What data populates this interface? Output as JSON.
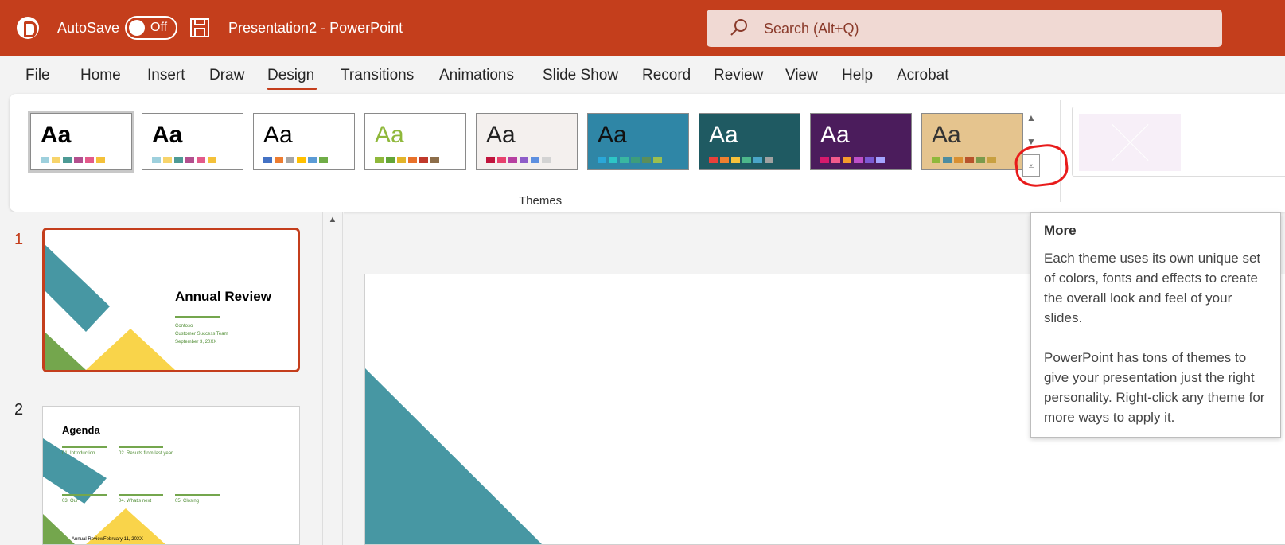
{
  "app": {
    "autosave_label": "AutoSave",
    "autosave_state": "Off",
    "document_title": "Presentation2  -  PowerPoint",
    "search_placeholder": "Search (Alt+Q)"
  },
  "tabs": [
    "File",
    "Home",
    "Insert",
    "Draw",
    "Design",
    "Transitions",
    "Animations",
    "Slide Show",
    "Record",
    "Review",
    "View",
    "Help",
    "Acrobat"
  ],
  "active_tab": "Design",
  "ribbon": {
    "group_label": "Themes",
    "themes": [
      {
        "label": "Aa",
        "bg": "#ffffff",
        "text": "#000000",
        "swatches": [
          "#9ed0dd",
          "#f7d46b",
          "#4d9a95",
          "#b34f8e",
          "#e35a8a",
          "#f4c13a"
        ]
      },
      {
        "label": "Aa",
        "bg": "#ffffff",
        "text": "#000000",
        "swatches": [
          "#9ed0dd",
          "#f7d46b",
          "#4d9a95",
          "#b34f8e",
          "#e35a8a",
          "#f4c13a"
        ]
      },
      {
        "label": "Aa",
        "bg": "#ffffff",
        "text": "#000000",
        "swatches": [
          "#4472c4",
          "#ed7d31",
          "#a5a5a5",
          "#ffc000",
          "#5b9bd5",
          "#70ad47"
        ]
      },
      {
        "label": "Aa",
        "bg": "#ffffff",
        "text": "#8fb83b",
        "swatches": [
          "#8fb83b",
          "#63a537",
          "#e2b42a",
          "#e8712a",
          "#c0392b",
          "#8d6e4a"
        ]
      },
      {
        "label": "Aa",
        "bg": "#f4f0ee",
        "text": "#222222",
        "swatches": [
          "#c0143c",
          "#e8416d",
          "#b73fa0",
          "#8e5dc9",
          "#5d8fe0",
          "#d3d3d3"
        ]
      },
      {
        "label": "Aa",
        "bg": "#2f86a6",
        "text": "#111111",
        "swatches": [
          "#2aa7d8",
          "#2dc6c6",
          "#39b7a0",
          "#3d9d7b",
          "#5b8e5a",
          "#9bbf4f"
        ]
      },
      {
        "label": "Aa",
        "bg": "#1f5a62",
        "text": "#ffffff",
        "swatches": [
          "#e8403a",
          "#f07f2f",
          "#f6c13b",
          "#4cb78b",
          "#4aa5c8",
          "#a1a1a1"
        ]
      },
      {
        "label": "Aa",
        "bg": "#4b1c5c",
        "text": "#ffffff",
        "swatches": [
          "#d6196c",
          "#f25b8c",
          "#f59c2c",
          "#be4fc8",
          "#7b5ad3",
          "#a4a4ff"
        ]
      },
      {
        "label": "Aa",
        "bg": "#e5c48e",
        "text": "#333333",
        "swatches": [
          "#8fb83b",
          "#4d8ca0",
          "#d98f30",
          "#b8522b",
          "#7a9a4b",
          "#c8a040"
        ]
      }
    ]
  },
  "tooltip": {
    "title": "More",
    "p1": "Each theme uses its own unique set of colors, fonts and effects to create the overall look and feel of your slides.",
    "p2": "PowerPoint has tons of themes to give your presentation just the right personality. Right-click any theme for more ways to apply it."
  },
  "slides": [
    {
      "number": "1",
      "title": "Annual Review",
      "subtitle_lines": [
        "Contoso",
        "Customer Success Team",
        "September 3, 20XX"
      ]
    },
    {
      "number": "2",
      "title": "Agenda",
      "items": [
        "01. Introduction",
        "02. Results from last year",
        "03. Our",
        "04. What's next",
        "05. Closing"
      ],
      "footer_left": "Annual Review",
      "footer_right": "February 11, 20XX"
    }
  ],
  "colors": {
    "brand": "#c43e1c",
    "teal": "#4797a3",
    "green": "#74a64d",
    "yellow": "#f9d44a"
  }
}
